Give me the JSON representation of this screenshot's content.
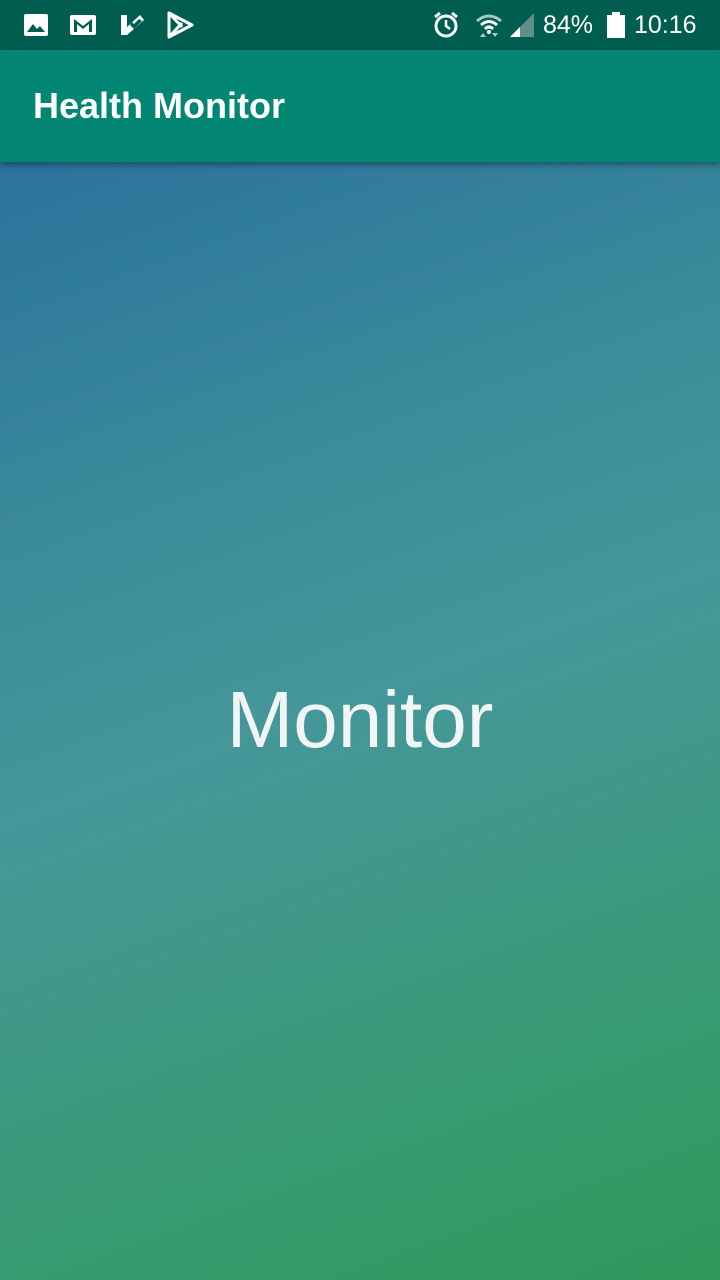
{
  "status_bar": {
    "battery_percent": "84%",
    "time": "10:16",
    "left_icons": [
      "image-icon",
      "gmail-icon",
      "check-app-icon",
      "play-store-icon"
    ],
    "right_icons": [
      "alarm-icon",
      "wifi-icon",
      "signal-icon",
      "battery-icon"
    ],
    "background_color": "#015d4f"
  },
  "app_bar": {
    "title": "Health Monitor",
    "background_color": "#038673"
  },
  "main": {
    "label": "Monitor",
    "gradient_colors": [
      "#2a739d",
      "#45979a",
      "#2f985a"
    ]
  }
}
